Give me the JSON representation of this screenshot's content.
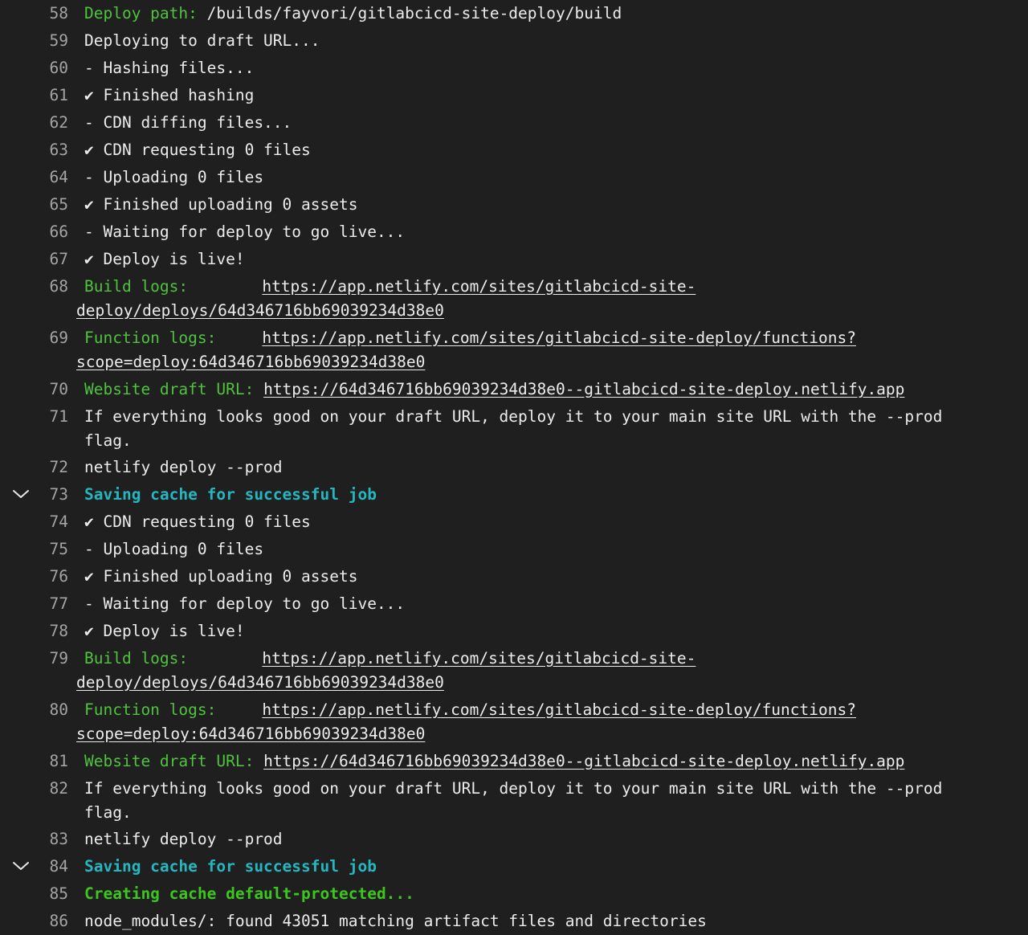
{
  "log": {
    "lines": [
      {
        "n": "58",
        "kind": "label",
        "label": "Deploy path:",
        "text": " /builds/fayvori/gitlabcicd-site-deploy/build"
      },
      {
        "n": "59",
        "kind": "plain",
        "text": "Deploying to draft URL..."
      },
      {
        "n": "60",
        "kind": "plain",
        "text": "- Hashing files..."
      },
      {
        "n": "61",
        "kind": "plain",
        "text": "✔ Finished hashing"
      },
      {
        "n": "62",
        "kind": "plain",
        "text": "- CDN diffing files..."
      },
      {
        "n": "63",
        "kind": "plain",
        "text": "✔ CDN requesting 0 files"
      },
      {
        "n": "64",
        "kind": "plain",
        "text": "- Uploading 0 files"
      },
      {
        "n": "65",
        "kind": "plain",
        "text": "✔ Finished uploading 0 assets"
      },
      {
        "n": "66",
        "kind": "plain",
        "text": "- Waiting for deploy to go live..."
      },
      {
        "n": "67",
        "kind": "plain",
        "text": "✔ Deploy is live!"
      },
      {
        "n": "68",
        "kind": "link",
        "label": "Build logs:",
        "pad": "       ",
        "url": "https://app.netlify.com/sites/gitlabcicd-site-deploy/deploys/64d346716bb69039234d38e0"
      },
      {
        "n": "69",
        "kind": "link",
        "label": "Function logs:",
        "pad": "    ",
        "url": "https://app.netlify.com/sites/gitlabcicd-site-deploy/functions?scope=deploy:64d346716bb69039234d38e0"
      },
      {
        "n": "70",
        "kind": "link",
        "label": "Website draft URL:",
        "pad": " ",
        "url": "https://64d346716bb69039234d38e0--gitlabcicd-site-deploy.netlify.app"
      },
      {
        "n": "71",
        "kind": "plain",
        "text": "If everything looks good on your draft URL, deploy it to your main site URL with the --prod flag."
      },
      {
        "n": "72",
        "kind": "plain",
        "text": "netlify deploy --prod"
      },
      {
        "n": "73",
        "kind": "section",
        "text": "Saving cache for successful job",
        "collapsible": true
      },
      {
        "n": "74",
        "kind": "plain",
        "text": "✔ CDN requesting 0 files"
      },
      {
        "n": "75",
        "kind": "plain",
        "text": "- Uploading 0 files"
      },
      {
        "n": "76",
        "kind": "plain",
        "text": "✔ Finished uploading 0 assets"
      },
      {
        "n": "77",
        "kind": "plain",
        "text": "- Waiting for deploy to go live..."
      },
      {
        "n": "78",
        "kind": "plain",
        "text": "✔ Deploy is live!"
      },
      {
        "n": "79",
        "kind": "link",
        "label": "Build logs:",
        "pad": "       ",
        "url": "https://app.netlify.com/sites/gitlabcicd-site-deploy/deploys/64d346716bb69039234d38e0"
      },
      {
        "n": "80",
        "kind": "link",
        "label": "Function logs:",
        "pad": "    ",
        "url": "https://app.netlify.com/sites/gitlabcicd-site-deploy/functions?scope=deploy:64d346716bb69039234d38e0"
      },
      {
        "n": "81",
        "kind": "link",
        "label": "Website draft URL:",
        "pad": " ",
        "url": "https://64d346716bb69039234d38e0--gitlabcicd-site-deploy.netlify.app"
      },
      {
        "n": "82",
        "kind": "plain",
        "text": "If everything looks good on your draft URL, deploy it to your main site URL with the --prod flag."
      },
      {
        "n": "83",
        "kind": "plain",
        "text": "netlify deploy --prod"
      },
      {
        "n": "84",
        "kind": "section",
        "text": "Saving cache for successful job",
        "collapsible": true
      },
      {
        "n": "85",
        "kind": "bold",
        "text": "Creating cache default-protected..."
      },
      {
        "n": "86",
        "kind": "plain",
        "text": "node_modules/: found 43051 matching artifact files and directories"
      }
    ]
  },
  "colors": {
    "background": "#1f1f1f",
    "text": "#ececec",
    "line_number": "#a4a4a4",
    "label_green": "#4fc23e",
    "section_cyan": "#25b6c0",
    "bold_green": "#3cc61f"
  },
  "icons": {
    "section_toggle": "chevron-down-icon"
  }
}
